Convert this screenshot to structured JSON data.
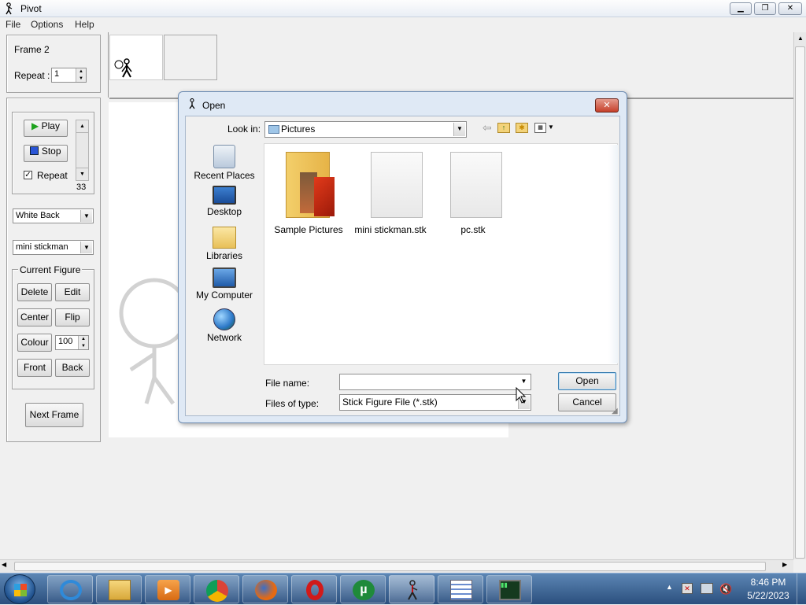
{
  "app": {
    "title": "Pivot",
    "menu": [
      "File",
      "Options",
      "Help"
    ]
  },
  "left_panel": {
    "frame_label": "Frame 2",
    "repeat_label": "Repeat :",
    "repeat_value": "1",
    "play_label": "Play",
    "stop_label": "Stop",
    "repeat_check_label": "Repeat",
    "speed_value": "33",
    "background_select": "White Back",
    "figure_select": "mini stickman",
    "current_figure_label": "Current Figure",
    "delete_label": "Delete",
    "edit_label": "Edit",
    "center_label": "Center",
    "flip_label": "Flip",
    "colour_label": "Colour",
    "colour_value": "100",
    "front_label": "Front",
    "back_label": "Back",
    "next_frame_label": "Next Frame"
  },
  "dialog": {
    "title": "Open",
    "look_in_label": "Look in:",
    "look_in_value": "Pictures",
    "places": [
      "Recent Places",
      "Desktop",
      "Libraries",
      "My Computer",
      "Network"
    ],
    "files": [
      {
        "name": "Sample Pictures",
        "icon": "folder-icon"
      },
      {
        "name": "mini stickman.stk",
        "icon": "file-icon"
      },
      {
        "name": "pc.stk",
        "icon": "file-icon"
      }
    ],
    "file_name_label": "File name:",
    "file_name_value": "",
    "files_of_type_label": "Files of type:",
    "files_of_type_value": "Stick Figure File (*.stk)",
    "open_label": "Open",
    "cancel_label": "Cancel"
  },
  "taskbar": {
    "time": "8:46 PM",
    "date": "5/22/2023",
    "apps": [
      "internet-explorer-icon",
      "file-explorer-icon",
      "media-player-icon",
      "chrome-icon",
      "firefox-icon",
      "opera-icon",
      "utorrent-icon",
      "pivot-icon",
      "list-app-icon",
      "terminal-icon"
    ]
  }
}
